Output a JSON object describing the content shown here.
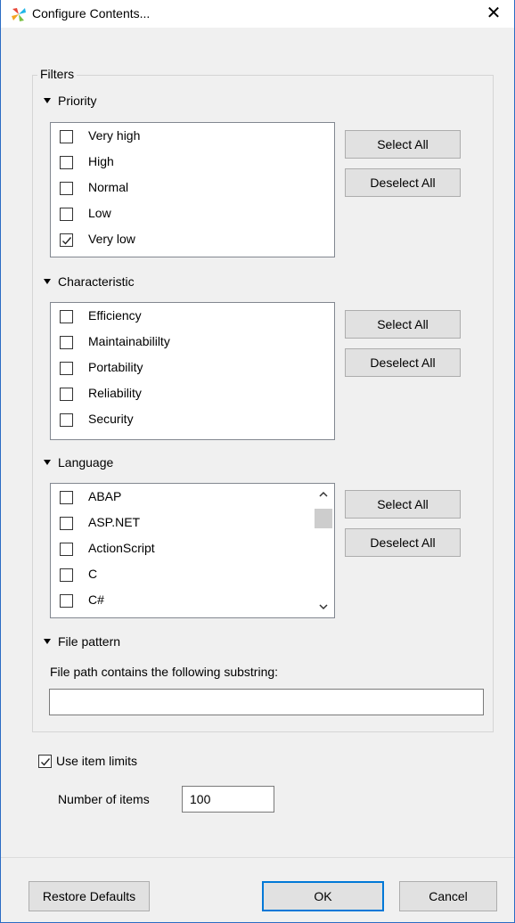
{
  "window": {
    "title": "Configure Contents...",
    "close_glyph": "✕"
  },
  "filters": {
    "label": "Filters",
    "priority": {
      "header": "Priority",
      "items": [
        {
          "label": "Very high",
          "checked": false
        },
        {
          "label": "High",
          "checked": false
        },
        {
          "label": "Normal",
          "checked": false
        },
        {
          "label": "Low",
          "checked": false
        },
        {
          "label": "Very low",
          "checked": true
        }
      ],
      "select_all": "Select All",
      "deselect_all": "Deselect All"
    },
    "characteristic": {
      "header": "Characteristic",
      "items": [
        {
          "label": "Efficiency",
          "checked": false
        },
        {
          "label": "Maintainabililty",
          "checked": false
        },
        {
          "label": "Portability",
          "checked": false
        },
        {
          "label": "Reliability",
          "checked": false
        },
        {
          "label": "Security",
          "checked": false
        }
      ],
      "select_all": "Select All",
      "deselect_all": "Deselect All"
    },
    "language": {
      "header": "Language",
      "items": [
        {
          "label": "ABAP",
          "checked": false
        },
        {
          "label": "ASP.NET",
          "checked": false
        },
        {
          "label": "ActionScript",
          "checked": false
        },
        {
          "label": "C",
          "checked": false
        },
        {
          "label": "C#",
          "checked": false
        }
      ],
      "select_all": "Select All",
      "deselect_all": "Deselect All"
    },
    "file_pattern": {
      "header": "File pattern",
      "description": "File path contains the following substring:",
      "value": ""
    }
  },
  "limits": {
    "use_item_limits_label": "Use item limits",
    "use_item_limits_checked": true,
    "number_of_items_label": "Number of items",
    "number_of_items_value": "100"
  },
  "footer": {
    "restore_defaults": "Restore Defaults",
    "ok": "OK",
    "cancel": "Cancel"
  },
  "icons": {
    "app_icon": "colorful-pinwheel-icon",
    "scroll_up": "chevron-up-icon",
    "scroll_down": "chevron-down-icon"
  }
}
